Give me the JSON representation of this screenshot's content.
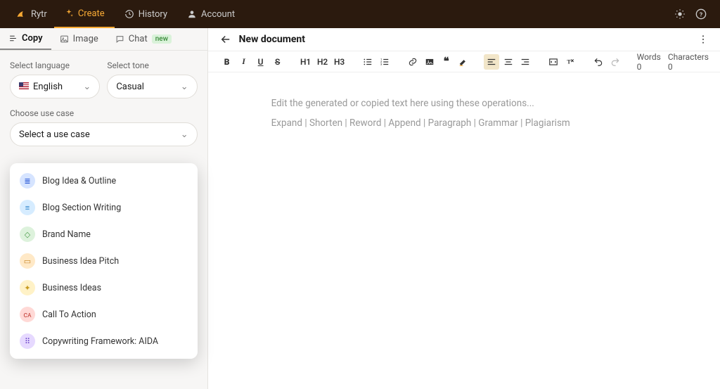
{
  "topbar": {
    "brand": "Rytr",
    "nav": {
      "create": "Create",
      "history": "History",
      "account": "Account"
    }
  },
  "sidebar": {
    "tabs": {
      "copy": "Copy",
      "image": "Image",
      "chat": "Chat",
      "chat_badge": "new"
    },
    "labels": {
      "language": "Select language",
      "tone": "Select tone",
      "usecase": "Choose use case"
    },
    "selects": {
      "language": "English",
      "tone": "Casual",
      "usecase": "Select a use case"
    },
    "usecase_options": [
      {
        "label": "Blog Idea & Outline",
        "bg": "#d6e4ff",
        "fg": "#2d5ad6",
        "glyph": "≣"
      },
      {
        "label": "Blog Section Writing",
        "bg": "#d6ecff",
        "fg": "#2a82c9",
        "glyph": "≡"
      },
      {
        "label": "Brand Name",
        "bg": "#ddf2dc",
        "fg": "#4a9b4a",
        "glyph": "◇"
      },
      {
        "label": "Business Idea Pitch",
        "bg": "#ffe9c7",
        "fg": "#c7811e",
        "glyph": "▭"
      },
      {
        "label": "Business Ideas",
        "bg": "#fff2c7",
        "fg": "#c79a1e",
        "glyph": "✦"
      },
      {
        "label": "Call To Action",
        "bg": "#ffd9d6",
        "fg": "#c74a42",
        "glyph": "cᴀ"
      },
      {
        "label": "Copywriting Framework: AIDA",
        "bg": "#e6d9ff",
        "fg": "#6a42c7",
        "glyph": "⠿"
      }
    ]
  },
  "editor": {
    "title": "New document",
    "placeholder1": "Edit the generated or copied text here using these operations...",
    "placeholder2": "Expand | Shorten | Reword | Append | Paragraph | Grammar | Plagiarism",
    "words_label": "Words",
    "words_count": "0",
    "chars_label": "Characters",
    "chars_count": "0",
    "headings": {
      "h1": "H1",
      "h2": "H2",
      "h3": "H3"
    }
  }
}
